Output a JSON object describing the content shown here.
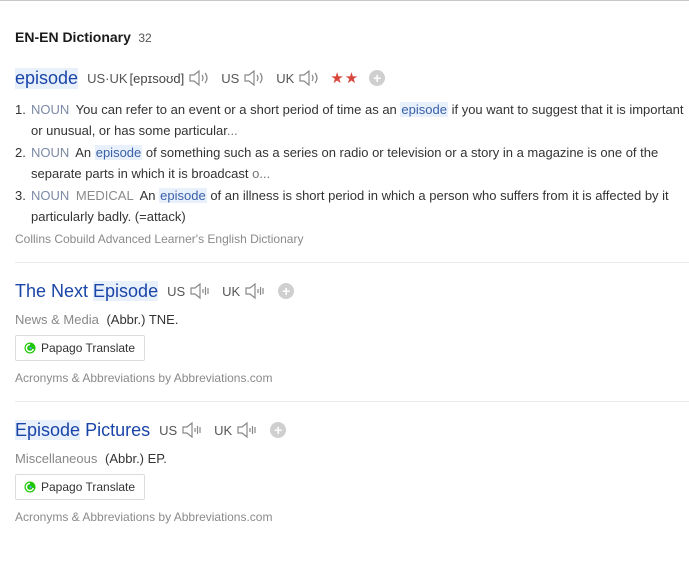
{
  "header": {
    "title": "EN-EN Dictionary",
    "count": "32"
  },
  "entry1": {
    "headword": "episode",
    "accent_label": "US·UK",
    "phonetic": "[epɪsoʊd]",
    "us_label": "US",
    "uk_label": "UK",
    "stars": "★★",
    "plus": "+",
    "definitions": [
      {
        "num": "1.",
        "pos": "NOUN",
        "domain": "",
        "before": "You can refer to an event or a short period of time as an",
        "keyword": "episode",
        "after": "if you want to suggest that it is important or unusual, or has some particular",
        "trunc": "..."
      },
      {
        "num": "2.",
        "pos": "NOUN",
        "domain": "",
        "before": "An",
        "keyword": "episode",
        "after": "of something such as a series on radio or television or a story in a magazine is one of the separate parts in which it is broadcast",
        "trunc": "o..."
      },
      {
        "num": "3.",
        "pos": "NOUN",
        "domain": "MEDICAL",
        "before": "An",
        "keyword": "episode",
        "after": "of an illness is short period in which a person who suffers from it is affected by it particularly badly. (=attack)",
        "trunc": ""
      }
    ],
    "source": "Collins Cobuild Advanced Learner's English Dictionary"
  },
  "entry2": {
    "headword_pre": "The Next ",
    "headword_hl": "Episode",
    "headword_post": "",
    "us_label": "US",
    "uk_label": "UK",
    "plus": "+",
    "category": "News & Media",
    "abbr": "(Abbr.) TNE.",
    "translate_label": "Papago Translate",
    "source": "Acronyms & Abbreviations by Abbreviations.com"
  },
  "entry3": {
    "headword_pre": "",
    "headword_hl": "Episode",
    "headword_post": " Pictures",
    "us_label": "US",
    "uk_label": "UK",
    "plus": "+",
    "category": "Miscellaneous",
    "abbr": "(Abbr.) EP.",
    "translate_label": "Papago Translate",
    "source": "Acronyms & Abbreviations by Abbreviations.com"
  },
  "colors": {
    "headword": "#1a45a8",
    "highlight": "#e8f1fb",
    "stars": "#d9463e",
    "papago_green": "#1ec800"
  },
  "icons": [
    "speaker-icon",
    "sound-wave-icon",
    "plus-icon",
    "star-icon",
    "papago-icon"
  ]
}
